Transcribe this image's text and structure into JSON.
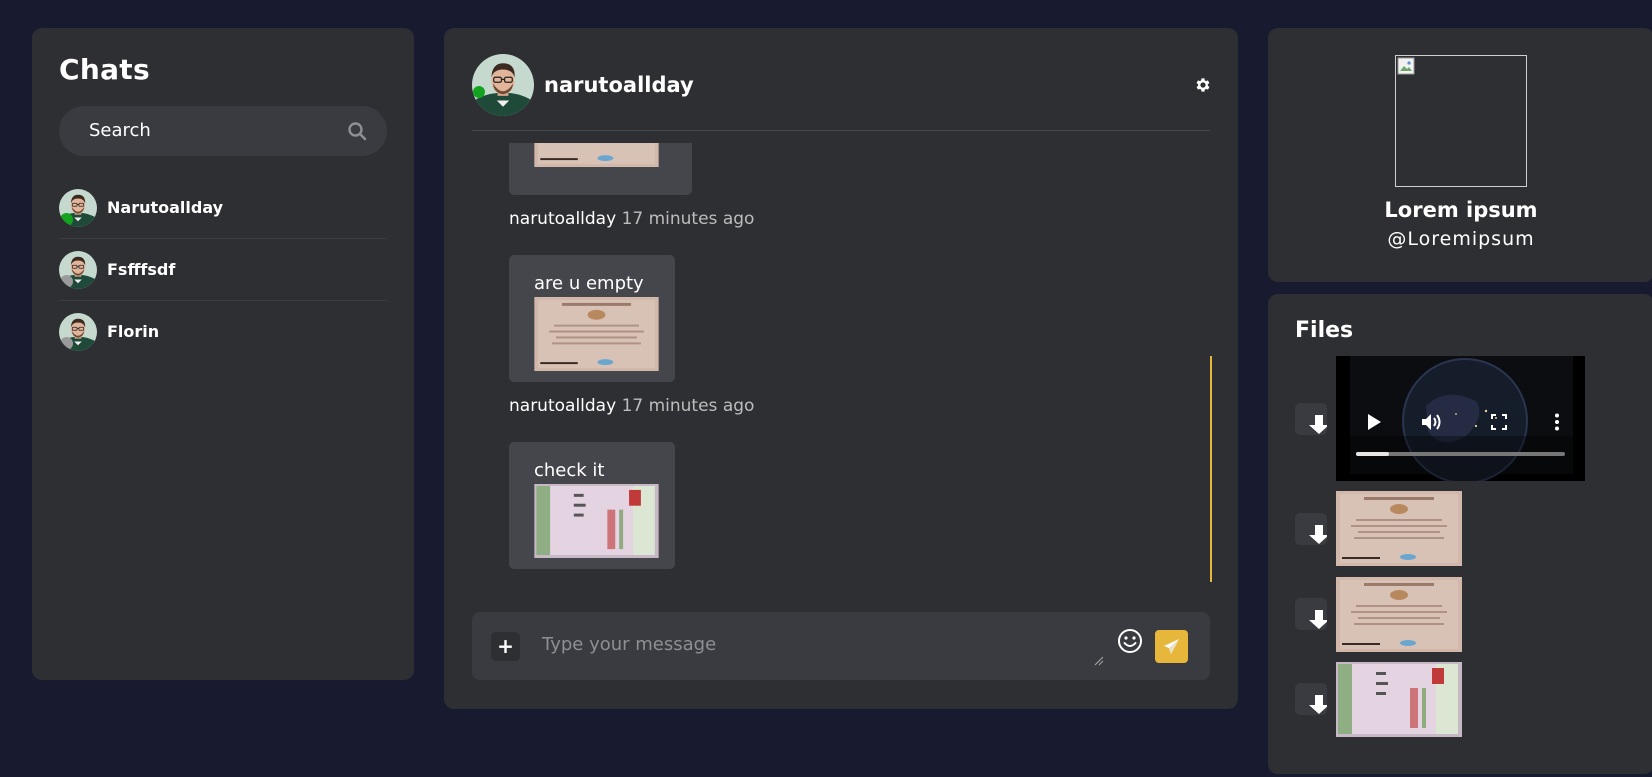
{
  "colors": {
    "background": "#181b30",
    "panel": "#2d2f33",
    "accent": "#e6b73b",
    "online": "#14a31f",
    "offline": "#9a9a9a"
  },
  "sidebar": {
    "title": "Chats",
    "search_placeholder": "Search",
    "search_icon": "search-icon",
    "items": [
      {
        "name": "Narutoallday",
        "status": "online"
      },
      {
        "name": "Fsfffsdf",
        "status": "offline"
      },
      {
        "name": "Florin",
        "status": "offline"
      }
    ]
  },
  "conversation": {
    "username": "narutoallday",
    "status": "online",
    "settings_icon": "gear-icon",
    "messages": [
      {
        "author": "narutoallday",
        "time": "17 minutes ago",
        "text": "are u empty",
        "attachment": "certificate-image"
      },
      {
        "author": "narutoallday",
        "time": "17 minutes ago",
        "text": "check it",
        "attachment": "id-card-image"
      }
    ],
    "composer": {
      "placeholder": "Type your message",
      "attach_icon": "plus-icon",
      "emoji_icon": "smiley-icon",
      "send_icon": "paper-plane-icon"
    }
  },
  "profile": {
    "name": "Lorem ipsum",
    "handle": "@Loremipsum"
  },
  "files": {
    "title": "Files",
    "items": [
      {
        "type": "video",
        "download_icon": "download-icon"
      },
      {
        "type": "image",
        "thumb": "certificate-image",
        "download_icon": "download-icon"
      },
      {
        "type": "image",
        "thumb": "certificate-image",
        "download_icon": "download-icon"
      },
      {
        "type": "image",
        "thumb": "id-card-image",
        "download_icon": "download-icon"
      }
    ],
    "video_progress": 0.16
  }
}
